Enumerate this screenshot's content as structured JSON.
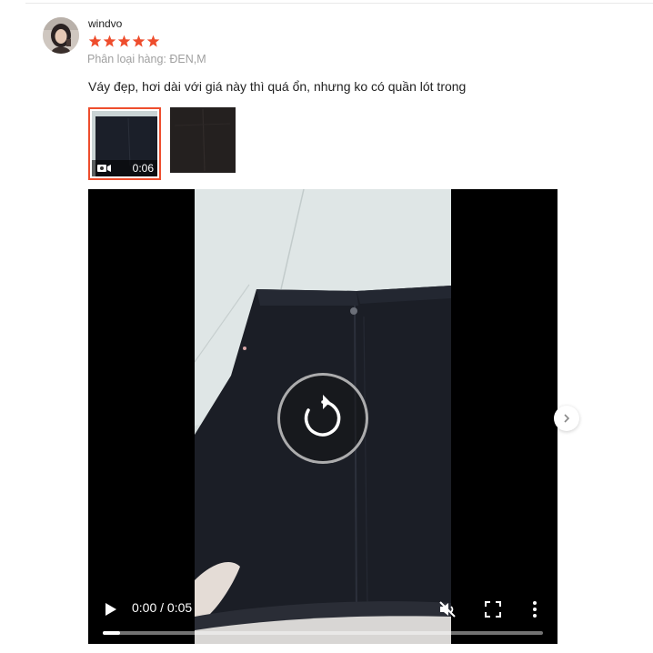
{
  "review": {
    "username": "windvo",
    "rating": 5,
    "variation": "Phân loại hàng: ĐEN,M",
    "comment": "Váy đẹp, hơi dài với giá này thì quá ổn, nhưng ko có quần lót trong"
  },
  "media": {
    "thumbnails": [
      {
        "type": "video",
        "duration": "0:06",
        "selected": true
      },
      {
        "type": "image",
        "selected": false
      }
    ]
  },
  "player": {
    "time": "0:00 / 0:05",
    "progress": 0.04,
    "muted": true,
    "icons": {
      "replay": "replay-icon",
      "play": "play-icon",
      "mute": "volume-muted-icon",
      "fullscreen": "fullscreen-icon",
      "more": "more-vertical-icon",
      "next": "chevron-right-icon"
    }
  },
  "colors": {
    "accent": "#ee4d2d",
    "star": "#ee4d2d",
    "muted_text": "#a0a0a0"
  }
}
